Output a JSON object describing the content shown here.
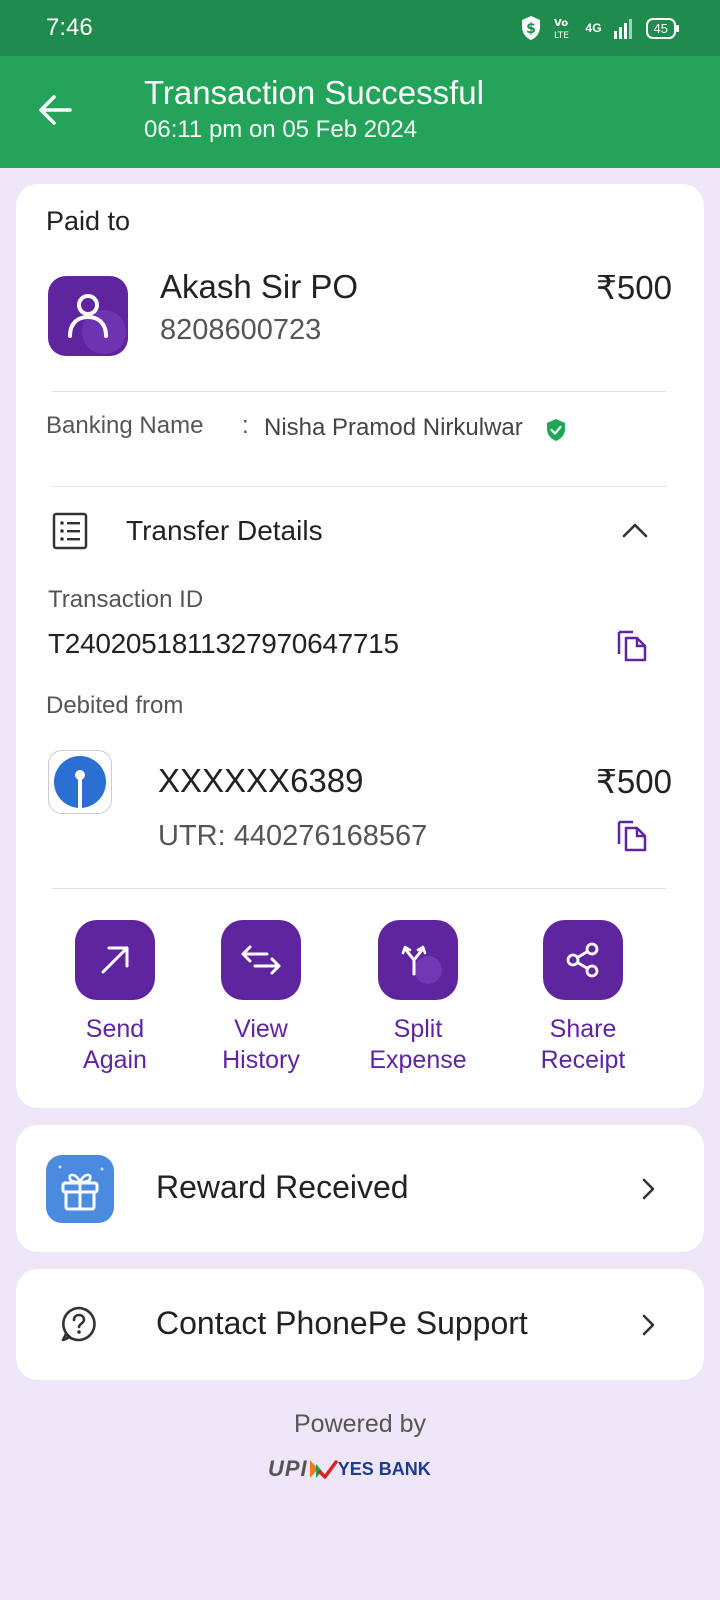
{
  "status_bar": {
    "time": "7:46",
    "network": "4G",
    "battery": "45"
  },
  "header": {
    "title": "Transaction Successful",
    "subtitle": "06:11 pm on 05 Feb 2024"
  },
  "payee": {
    "section_label": "Paid to",
    "name": "Akash Sir PO",
    "phone": "8208600723",
    "amount": "₹500",
    "banking_name_label": "Banking Name",
    "separator": ":",
    "banking_name": "Nisha Pramod Nirkulwar"
  },
  "transfer": {
    "title": "Transfer Details",
    "transaction_id_label": "Transaction ID",
    "transaction_id": "T2402051811327970647715",
    "debited_label": "Debited from",
    "account": "XXXXXX6389",
    "amount": "₹500",
    "utr": "UTR: 440276168567"
  },
  "actions": [
    {
      "line1": "Send",
      "line2": "Again",
      "icon": "arrow-up-right-icon"
    },
    {
      "line1": "View",
      "line2": "History",
      "icon": "swap-arrows-icon"
    },
    {
      "line1": "Split",
      "line2": "Expense",
      "icon": "split-icon"
    },
    {
      "line1": "Share",
      "line2": "Receipt",
      "icon": "share-icon"
    }
  ],
  "reward": {
    "label": "Reward Received",
    "icon": "gift-icon"
  },
  "support": {
    "label": "Contact PhonePe Support",
    "icon": "help-circle-icon"
  },
  "footer": {
    "powered_by": "Powered by",
    "upi_logo_text": "UPI",
    "bank_logo_text": "YES BANK"
  },
  "colors": {
    "header_green": "#24a35a",
    "status_green": "#1f8b4c",
    "brand_purple": "#5f259f",
    "background": "#eee6f7",
    "verified_green": "#21a557"
  }
}
